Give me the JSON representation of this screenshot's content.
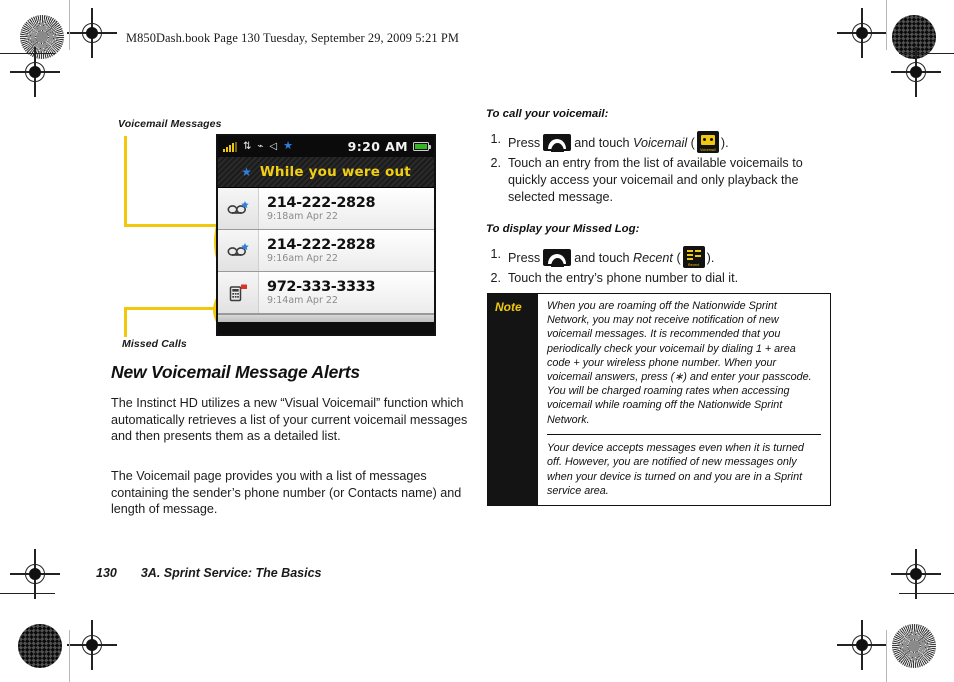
{
  "running_header": "M850Dash.book  Page 130  Tuesday, September 29, 2009  5:21 PM",
  "callouts": {
    "voicemail_messages": "Voicemail Messages",
    "missed_calls": "Missed Calls"
  },
  "phone_screen": {
    "status_bar": {
      "signal_icon": "signal-bars-icon",
      "data_icon": "data-connection-icon",
      "bluetooth_icon": "bluetooth-icon",
      "speaker_icon": "speaker-icon",
      "star_icon": "star-icon",
      "time": "9:20 AM",
      "battery_icon": "battery-icon"
    },
    "banner": {
      "star": "★",
      "title": "While you were out"
    },
    "entries": [
      {
        "icon": "voicemail-new-icon",
        "number": "214-222-2828",
        "timestamp": "9:18am Apr 22"
      },
      {
        "icon": "voicemail-new-icon",
        "number": "214-222-2828",
        "timestamp": "9:16am Apr 22"
      },
      {
        "icon": "missed-call-icon",
        "number": "972-333-3333",
        "timestamp": "9:14am Apr 22"
      }
    ]
  },
  "section": {
    "heading": "New Voicemail Message Alerts",
    "paragraph_1": "The Instinct HD utilizes a new “Visual Voicemail” function which automatically retrieves a list of your current voicemail messages and then presents them as a detailed list.",
    "paragraph_2": "The Voicemail page provides you with a list of messages containing the sender’s phone number (or Contacts name) and length of message."
  },
  "procedures": [
    {
      "title": "To call your voicemail:",
      "steps": [
        {
          "n": "1.",
          "pre": "Press",
          "key": "end-key-icon",
          "mid": "and touch",
          "em": "Voicemail",
          "paren_open": "(",
          "icon": "voicemail-app-icon",
          "icon_caption": "Voicemail",
          "paren_close": ")."
        },
        {
          "n": "2.",
          "text": "Touch an entry from the list of available voicemails to quickly access your voicemail and only playback the selected message."
        }
      ]
    },
    {
      "title": "To display your Missed Log:",
      "steps": [
        {
          "n": "1.",
          "pre": "Press",
          "key": "end-key-icon",
          "mid": "and touch",
          "em": "Recent",
          "paren_open": "(",
          "icon": "recent-app-icon",
          "icon_caption": "Recent",
          "paren_close": ")."
        },
        {
          "n": "2.",
          "text": "Touch the entry’s phone number to dial it."
        }
      ]
    }
  ],
  "note": {
    "label": "Note",
    "paragraph_1": "When you are roaming off the Nationwide Sprint Network, you may not receive notification of new voicemail messages. It is recommended that you periodically check your voicemail by dialing 1 + area code + your wireless phone number. When your voicemail answers, press (∗) and enter your passcode. You will be charged roaming rates when accessing voicemail while roaming off the Nationwide Sprint Network.",
    "paragraph_2": "Your device accepts messages even when it is turned off. However, you are notified of new messages only when your device is turned on and you are in a Sprint service area."
  },
  "footer": {
    "page_number": "130",
    "section_title": "3A. Sprint Service: The Basics"
  },
  "colors": {
    "accent_yellow": "#f2c80f",
    "note_yellow": "#f2c80f",
    "screen_black": "#0c0c0c",
    "star_blue": "#2f7fe0",
    "battery_green": "#35b425",
    "missed_red": "#d9342b"
  }
}
